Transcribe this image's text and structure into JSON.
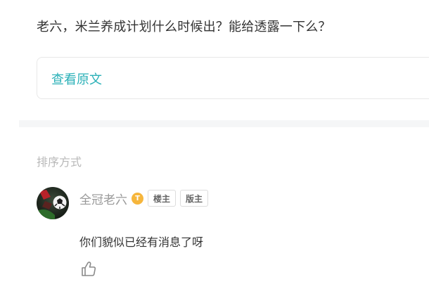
{
  "post": {
    "question": "老六，米兰养成计划什么时候出？能给透露一下么？",
    "view_original": "查看原文"
  },
  "comments": {
    "sort_label": "排序方式",
    "items": [
      {
        "author": "全冠老六",
        "level_badge": "T",
        "badges": [
          "楼主",
          "版主"
        ],
        "text": "你们貌似已经有消息了呀",
        "like_icon": "thumbs-up-icon"
      }
    ]
  },
  "colors": {
    "accent": "#2bb1b8",
    "level_badge": "#f6b63c",
    "muted_text": "#999999",
    "divider_bg": "#f5f6f7"
  }
}
